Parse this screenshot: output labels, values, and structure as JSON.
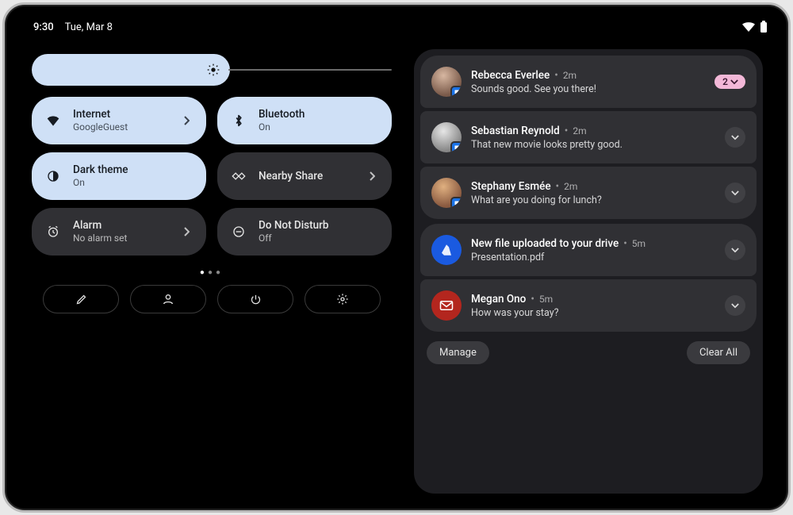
{
  "statusbar": {
    "time": "9:30",
    "date": "Tue, Mar 8"
  },
  "brightness": {
    "percent": 55
  },
  "tiles": [
    {
      "title": "Internet",
      "subtitle": "GoogleGuest",
      "icon": "wifi",
      "active": true,
      "chevron": true,
      "name": "tile-internet"
    },
    {
      "title": "Bluetooth",
      "subtitle": "On",
      "icon": "bluetooth",
      "active": true,
      "chevron": false,
      "name": "tile-bluetooth"
    },
    {
      "title": "Dark theme",
      "subtitle": "On",
      "icon": "dark-theme",
      "active": true,
      "chevron": false,
      "name": "tile-dark-theme"
    },
    {
      "title": "Nearby Share",
      "subtitle": "",
      "icon": "nearby",
      "active": false,
      "chevron": true,
      "name": "tile-nearby-share"
    },
    {
      "title": "Alarm",
      "subtitle": "No alarm set",
      "icon": "alarm",
      "active": false,
      "chevron": true,
      "name": "tile-alarm"
    },
    {
      "title": "Do Not Disturb",
      "subtitle": "Off",
      "icon": "dnd",
      "active": false,
      "chevron": false,
      "name": "tile-dnd"
    }
  ],
  "pager": {
    "pages": 3,
    "current": 0
  },
  "actions": [
    {
      "icon": "edit",
      "name": "action-edit"
    },
    {
      "icon": "user",
      "name": "action-user"
    },
    {
      "icon": "power",
      "name": "action-power"
    },
    {
      "icon": "settings",
      "name": "action-settings"
    }
  ],
  "notifications": {
    "group_messages": [
      {
        "sender": "Rebecca Everlee",
        "time": "2m",
        "body": "Sounds good. See you there!",
        "badge_count": "2",
        "app": "messages",
        "name": "notif-rebecca"
      },
      {
        "sender": "Sebastian Reynold",
        "time": "2m",
        "body": "That new movie looks pretty good.",
        "app": "messages",
        "name": "notif-sebastian"
      },
      {
        "sender": "Stephany Esmée",
        "time": "2m",
        "body": "What are you doing for lunch?",
        "app": "messages",
        "name": "notif-stephany"
      }
    ],
    "others": [
      {
        "title": "New file uploaded to your drive",
        "time": "5m",
        "body": "Presentation.pdf",
        "app": "drive",
        "name": "notif-drive"
      },
      {
        "title": "Megan Ono",
        "time": "5m",
        "body": "How was your stay?",
        "app": "gmail",
        "name": "notif-megan"
      }
    ],
    "actions": {
      "manage": "Manage",
      "clear_all": "Clear All"
    }
  }
}
